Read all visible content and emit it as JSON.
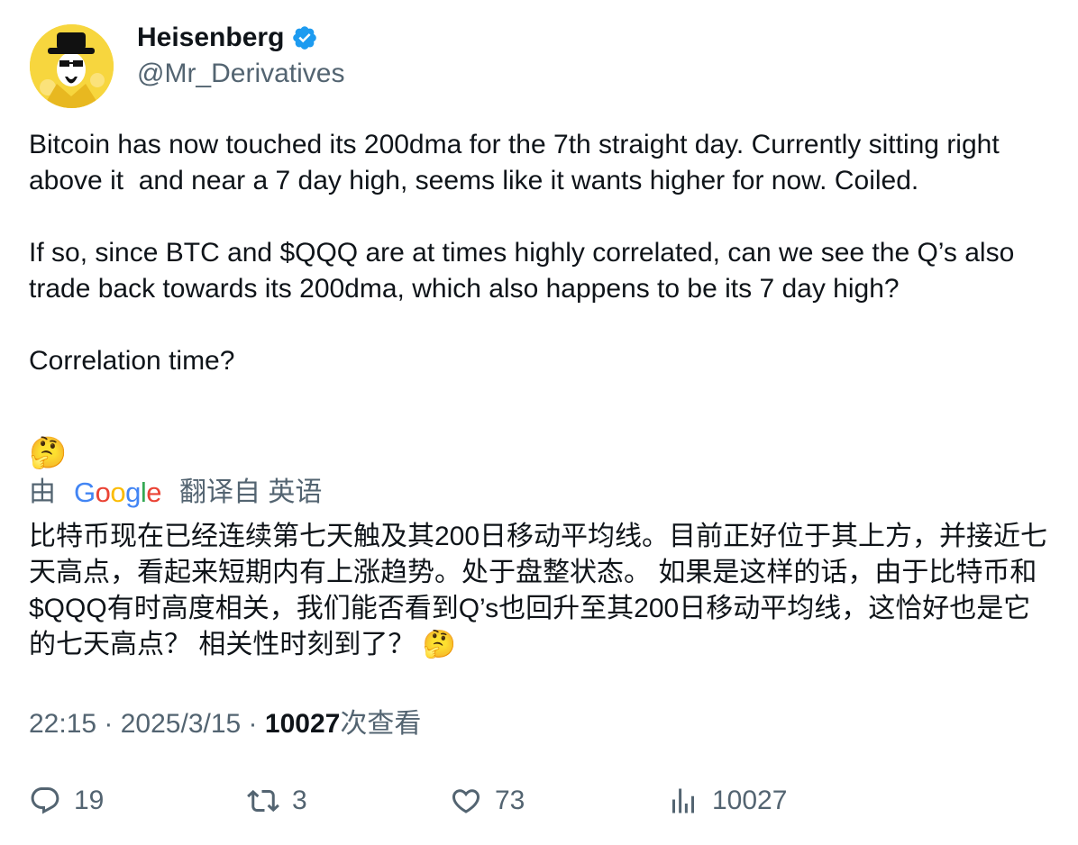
{
  "author": {
    "name": "Heisenberg",
    "handle": "@Mr_Derivatives",
    "verified_color": "#1d9bf0"
  },
  "tweet": {
    "paragraphs": [
      "Bitcoin has now touched its 200dma for the 7th straight day. Currently sitting right above it  and near a 7 day high, seems like it wants higher for now. Coiled.",
      "If so, since BTC and $QQQ are at times highly correlated, can we see the Q’s also trade back towards its 200dma, which also happens to be its 7 day high?",
      "Correlation time?",
      "🤔"
    ]
  },
  "translation": {
    "by": "由",
    "brand": "Google",
    "from": "翻译自 英语",
    "text": "比特币现在已经连续第七天触及其200日移动平均线。目前正好位于其上方，并接近七天高点，看起来短期内有上涨趋势。处于盘整状态。 如果是这样的话，由于比特币和$QQQ有时高度相关，我们能否看到Q’s也回升至其200日移动平均线，这恰好也是它的七天高点？ 相关性时刻到了？ 🤔"
  },
  "meta": {
    "time": "22:15",
    "sep1": " · ",
    "date": "2025/3/15",
    "sep2": " · ",
    "views": "10027",
    "views_label": "次查看"
  },
  "actions": {
    "replies": "19",
    "retweets": "3",
    "likes": "73",
    "views": "10027"
  }
}
